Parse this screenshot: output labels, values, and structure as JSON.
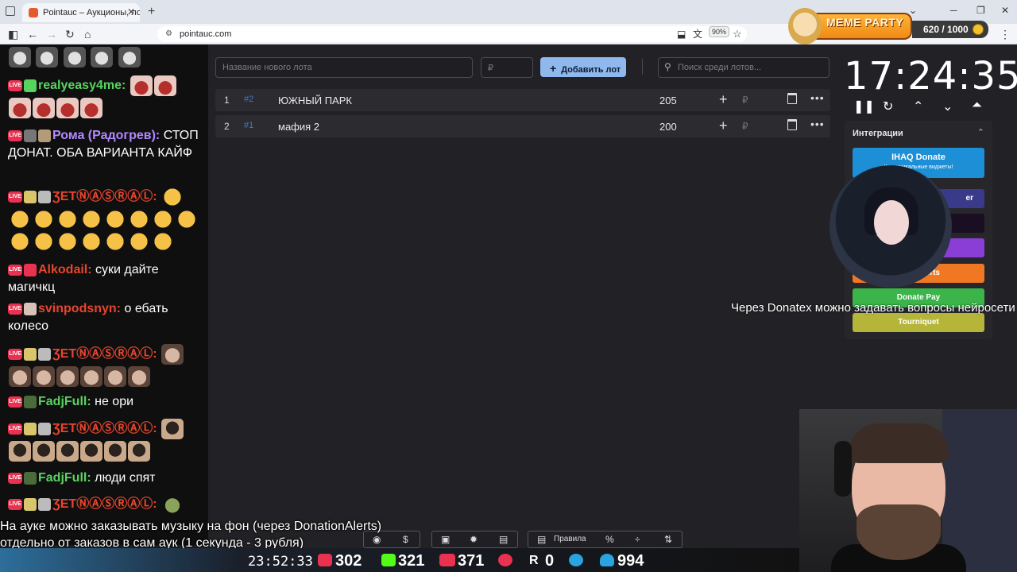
{
  "browser": {
    "tab_title": "Pointauc – Аукционы, лотереи",
    "new_tab": "+",
    "url": "pointauc.com",
    "zoom": "90%"
  },
  "meme_party": {
    "title": "MEME PARTY",
    "count": "620 / 1000"
  },
  "chat": {
    "messages": [
      {
        "user": "realyeasy4me:",
        "user_color": "#58d35f",
        "text": ""
      },
      {
        "user": "Рома (Радогрев):",
        "user_color": "#b388ff",
        "text": "СТОП ДОНАТ. ОБА ВАРИАНТА КАЙФ"
      },
      {
        "user": "ƷETⓃⒶⓈⓇⒶⓁ:",
        "user_color": "#e8452c",
        "text": ""
      },
      {
        "user": "Alkodail:",
        "user_color": "#e8452c",
        "text": "суки дайте магичкц"
      },
      {
        "user": "svinpodsnyn:",
        "user_color": "#e8452c",
        "text": "о ебать колесо"
      },
      {
        "user": "ƷETⓃⒶⓈⓇⒶⓁ:",
        "user_color": "#e8452c",
        "text": ""
      },
      {
        "user": "FadjFull:",
        "user_color": "#58d35f",
        "text": "не ори"
      },
      {
        "user": "ƷETⓃⒶⓈⓇⒶⓁ:",
        "user_color": "#e8452c",
        "text": ""
      },
      {
        "user": "FadjFull:",
        "user_color": "#58d35f",
        "text": "люди спят"
      },
      {
        "user": "ƷETⓃⒶⓈⓇⒶⓁ:",
        "user_color": "#e8452c",
        "text": ""
      }
    ]
  },
  "auction": {
    "new_lot_placeholder": "Название нового лота",
    "amount_placeholder": "₽",
    "add_lot_label": "Добавить лот",
    "search_placeholder": "Поиск среди лотов...",
    "lots": [
      {
        "num": "1",
        "id": "#2",
        "name": "ЮЖНЫЙ ПАРК",
        "amount": "205",
        "currency": "₽"
      },
      {
        "num": "2",
        "id": "#1",
        "name": "мафия 2",
        "amount": "200",
        "currency": "₽"
      }
    ],
    "timer": "17:24:35",
    "integrations_title": "Интеграции",
    "integrations": [
      {
        "label": "IHAQ Donate",
        "sub": "Кр... уникальные виджеты!",
        "color": "#1d8fd6"
      },
      {
        "label": "er",
        "color": "#3a3a8a"
      },
      {
        "label": "",
        "color": "#1a0e22"
      },
      {
        "label": "",
        "color": "#8a3ed6"
      },
      {
        "label": "lerts",
        "color": "#f07822"
      },
      {
        "label": "Donate Pay",
        "color": "#3bb54a"
      },
      {
        "label": "Tourniquet",
        "color": "#b5b53a"
      }
    ],
    "rules_label": "Правила"
  },
  "overlays": {
    "donatex": "Через Donatex можно задавать вопросы нейросети",
    "music_line1": "На ауке можно заказывать музыку на фон (через DonationAlerts)",
    "music_line2": "отдельно от заказов в сам аук (1 секунда - 3 рубля)"
  },
  "stream_status": {
    "clock": "23:52:33",
    "youtube": "302",
    "kick": "321",
    "live": "371",
    "rutube": "0",
    "total": "994"
  }
}
